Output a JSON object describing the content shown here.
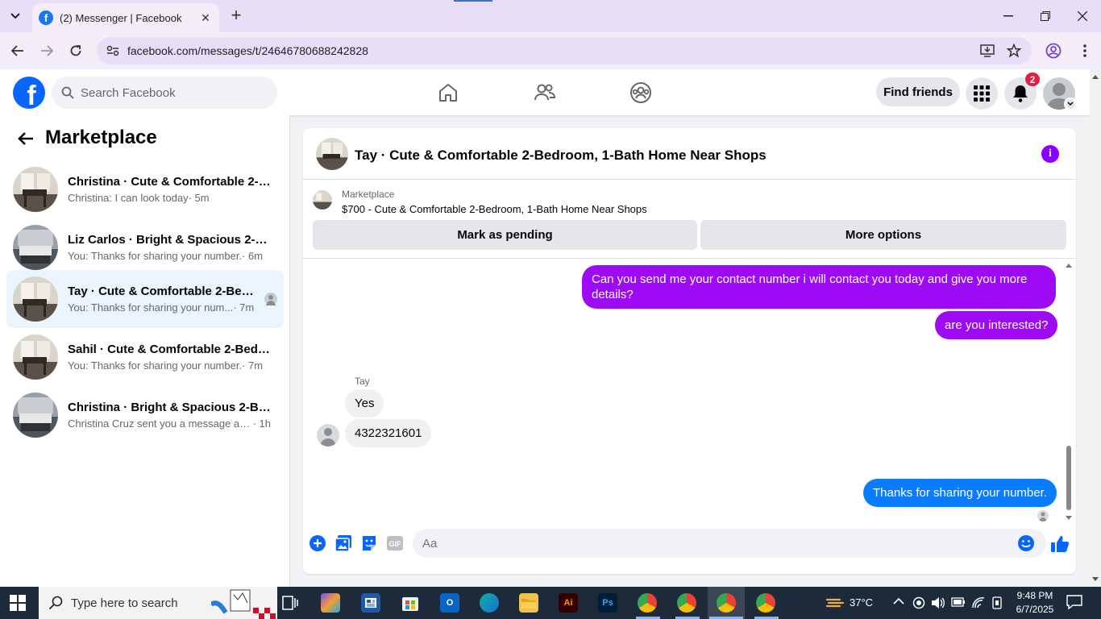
{
  "browser": {
    "tab_title": "(2) Messenger | Facebook",
    "url": "facebook.com/messages/t/24646780688242828"
  },
  "fb": {
    "logo": "f",
    "search_placeholder": "Search Facebook",
    "find_friends": "Find friends",
    "notif_count": "2"
  },
  "sidebar": {
    "title": "Marketplace",
    "conversations": [
      {
        "name": "Christina · Cute & Comfortable 2-B...",
        "snippet": "Christina: I can look today",
        "time": " · 5m",
        "active": false
      },
      {
        "name": "Liz Carlos · Bright & Spacious 2-Be...",
        "snippet": "You: Thanks for sharing your number.",
        "time": " · 6m",
        "active": false
      },
      {
        "name": "Tay · Cute & Comfortable 2-Bed...",
        "snippet": "You: Thanks for sharing your num...",
        "time": " · 7m",
        "active": true
      },
      {
        "name": "Sahil · Cute & Comfortable 2-Bedr...",
        "snippet": "You: Thanks for sharing your number.",
        "time": " · 7m",
        "active": false
      },
      {
        "name": "Christina · Bright & Spacious 2-Be...",
        "snippet": "Christina Cruz sent you a message ab...",
        "time": " · 1h",
        "active": false
      }
    ]
  },
  "chat": {
    "title": "Tay · Cute & Comfortable 2-Bedroom, 1-Bath Home Near Shops",
    "listing_label": "Marketplace",
    "listing_title": "$700 - Cute & Comfortable 2-Bedroom, 1-Bath Home Near Shops",
    "mark_pending": "Mark as pending",
    "more_options": "More options",
    "messages": [
      {
        "from": "me",
        "text": "Can you send me your contact number i will contact you today and give you more details?"
      },
      {
        "from": "me",
        "text": "are you interested?"
      },
      {
        "from": "Tay",
        "text": "Yes"
      },
      {
        "from": "Tay",
        "text": "4322321601"
      },
      {
        "from": "me",
        "text": "Thanks for sharing your number."
      }
    ],
    "sender_name": "Tay",
    "composer_placeholder": "Aa"
  },
  "taskbar": {
    "search_placeholder": "Type here to search",
    "temperature": "37°C",
    "time": "9:48 PM",
    "date": "6/7/2025"
  },
  "colors": {
    "fb_blue": "#0866ff",
    "bubble_purple": "#9d0bf5",
    "bubble_blue": "#0a7cff",
    "notif_red": "#e41e3f"
  }
}
